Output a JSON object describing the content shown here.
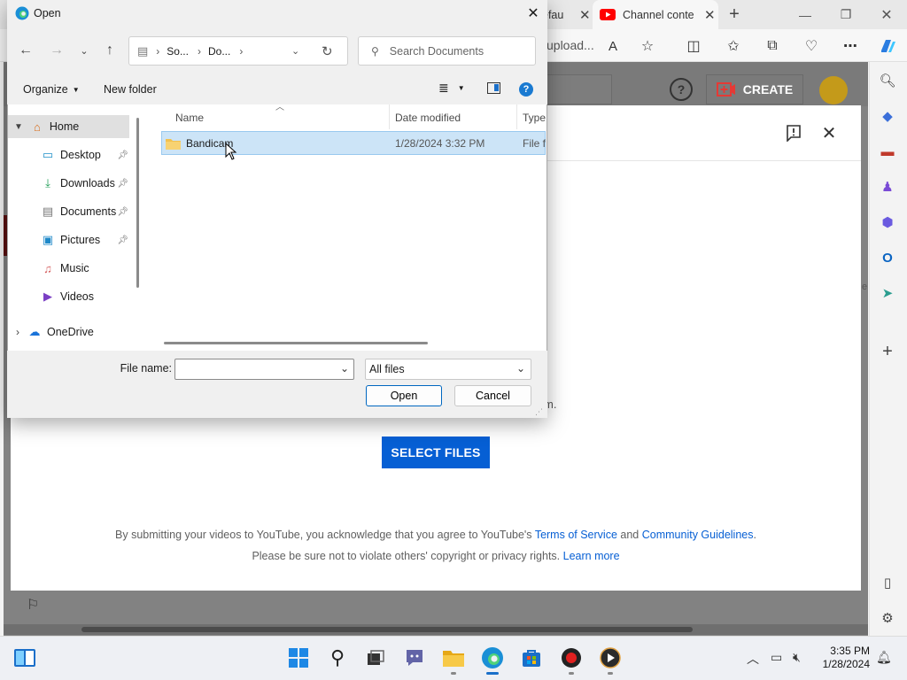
{
  "browser": {
    "tabs": [
      {
        "label": "efau",
        "active": false
      },
      {
        "label": "Channel conte",
        "active": true
      }
    ],
    "new_tab_symbol": "+",
    "address_partial": "upload...",
    "read_aloud_icon": "A",
    "window_controls": [
      "minimize-icon",
      "restore-icon",
      "close-icon"
    ]
  },
  "youtube": {
    "create_label": "CREATE",
    "select_files_label": "SELECT FILES",
    "partial_text_m": "m.",
    "partial_text_right": "e",
    "legal_line1_prefix": "By submitting your videos to YouTube, you acknowledge that you agree to YouTube's",
    "terms_link": "Terms of Service",
    "legal_and": "and",
    "guidelines_link": "Community Guidelines",
    "legal_line1_suffix": ".",
    "legal_line2_prefix": "Please be sure not to violate others' copyright or privacy rights.",
    "learn_more_link": "Learn more",
    "brand_color": "#065fd4"
  },
  "open_dialog": {
    "title": "Open",
    "breadcrumb": [
      "So...",
      "Do..."
    ],
    "search_placeholder": "Search Documents",
    "organize_label": "Organize",
    "new_folder_label": "New folder",
    "tree": [
      {
        "label": "Home",
        "icon": "home-icon",
        "selected": true,
        "pinned": false
      },
      {
        "label": "Desktop",
        "icon": "desktop-icon",
        "pinned": true
      },
      {
        "label": "Downloads",
        "icon": "download-icon",
        "pinned": true
      },
      {
        "label": "Documents",
        "icon": "document-icon",
        "pinned": true
      },
      {
        "label": "Pictures",
        "icon": "picture-icon",
        "pinned": true
      },
      {
        "label": "Music",
        "icon": "music-icon",
        "pinned": false
      },
      {
        "label": "Videos",
        "icon": "video-icon",
        "pinned": false
      },
      {
        "label": "OneDrive",
        "icon": "cloud-icon",
        "pinned": false
      }
    ],
    "columns": {
      "name": "Name",
      "date": "Date modified",
      "type": "Type"
    },
    "files": [
      {
        "name": "Bandicam",
        "date": "1/28/2024 3:32 PM",
        "type": "File fo"
      }
    ],
    "file_name_label": "File name:",
    "file_name_value": "",
    "filter_value": "All files",
    "open_label": "Open",
    "cancel_label": "Cancel"
  },
  "taskbar": {
    "time": "3:35 PM",
    "date": "1/28/2024"
  }
}
